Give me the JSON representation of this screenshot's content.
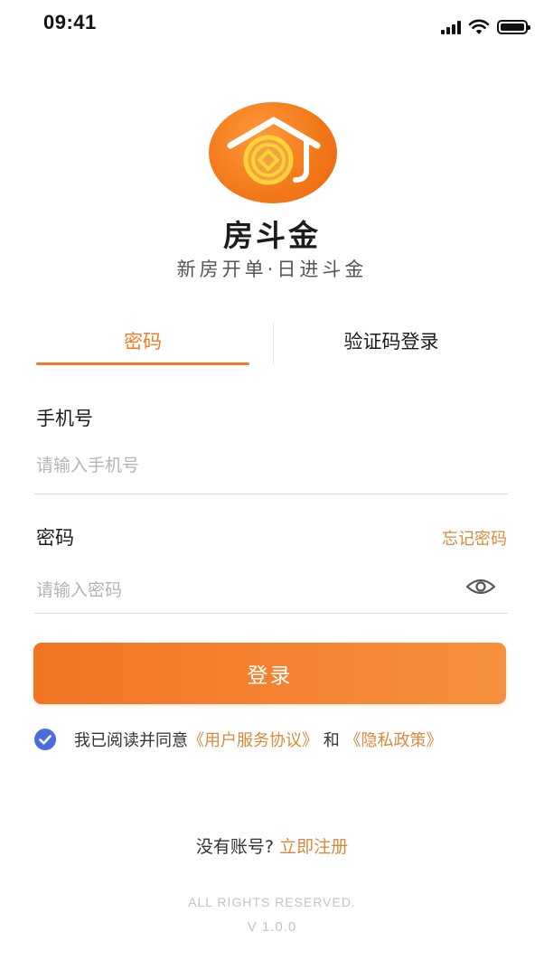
{
  "status_bar": {
    "time": "09:41",
    "icons": [
      "signal-icon",
      "wifi-icon",
      "battery-icon"
    ]
  },
  "app": {
    "logo_icon": "house-coin-icon",
    "name": "房斗金",
    "slogan": "新房开单·日进斗金"
  },
  "tabs": [
    {
      "label": "密码",
      "active": true
    },
    {
      "label": "验证码登录",
      "active": false
    }
  ],
  "form": {
    "phone_label": "手机号",
    "phone_placeholder": "请输入手机号",
    "phone_value": "",
    "password_label": "密码",
    "forgot_password": "忘记密码",
    "password_placeholder": "请输入密码",
    "password_value": "",
    "visibility_icon": "eye-icon"
  },
  "login_button": "登录",
  "agreement": {
    "checked": true,
    "prefix": "我已阅读并同意",
    "service_link": "《用户服务协议》",
    "and": "和",
    "privacy_link": "《隐私政策》"
  },
  "register": {
    "prompt": "没有账号?",
    "link": "立即注册"
  },
  "footer": {
    "rights": "ALL RIGHTS RESERVED.",
    "version": "V 1.0.0"
  },
  "colors": {
    "accent": "#f07c27",
    "link": "#d88a3b",
    "checkbox": "#4a6ee0"
  }
}
